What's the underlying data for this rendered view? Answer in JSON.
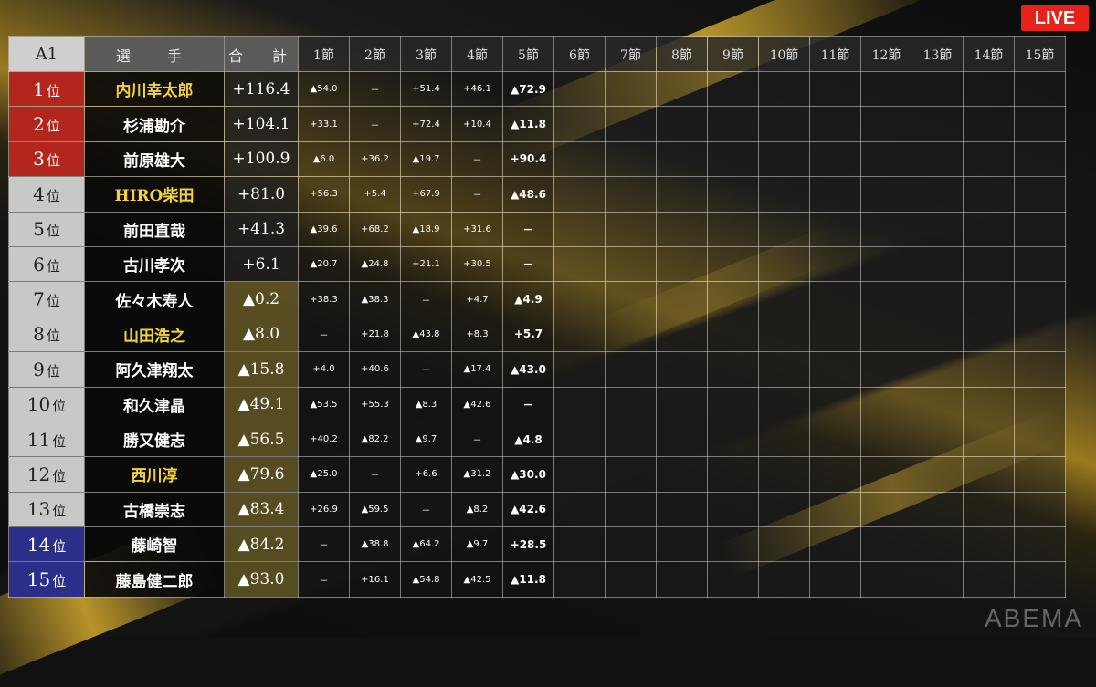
{
  "header": {
    "league": "A1",
    "player": "選　手",
    "total": "合　計",
    "rounds": [
      "1節",
      "2節",
      "3節",
      "4節",
      "5節",
      "6節",
      "7節",
      "8節",
      "9節",
      "10節",
      "11節",
      "12節",
      "13節",
      "14節",
      "15節"
    ]
  },
  "live_badge": "LIVE",
  "watermark": "ABEMA",
  "rank_unit": "位",
  "rows": [
    {
      "rank": "1",
      "name": "内川幸太郎",
      "total": "+116.4",
      "scores": [
        "▲54.0",
        "－",
        "+51.4",
        "+46.1",
        "▲72.9"
      ]
    },
    {
      "rank": "2",
      "name": "杉浦勘介",
      "total": "+104.1",
      "scores": [
        "+33.1",
        "－",
        "+72.4",
        "+10.4",
        "▲11.8"
      ]
    },
    {
      "rank": "3",
      "name": "前原雄大",
      "total": "+100.9",
      "scores": [
        "▲6.0",
        "+36.2",
        "▲19.7",
        "－",
        "+90.4"
      ]
    },
    {
      "rank": "4",
      "name": "HIRO柴田",
      "total": "+81.0",
      "scores": [
        "+56.3",
        "+5.4",
        "+67.9",
        "－",
        "▲48.6"
      ]
    },
    {
      "rank": "5",
      "name": "前田直哉",
      "total": "+41.3",
      "scores": [
        "▲39.6",
        "+68.2",
        "▲18.9",
        "+31.6",
        "－"
      ]
    },
    {
      "rank": "6",
      "name": "古川孝次",
      "total": "+6.1",
      "scores": [
        "▲20.7",
        "▲24.8",
        "+21.1",
        "+30.5",
        "－"
      ]
    },
    {
      "rank": "7",
      "name": "佐々木寿人",
      "total": "▲0.2",
      "scores": [
        "+38.3",
        "▲38.3",
        "－",
        "+4.7",
        "▲4.9"
      ]
    },
    {
      "rank": "8",
      "name": "山田浩之",
      "total": "▲8.0",
      "scores": [
        "－",
        "+21.8",
        "▲43.8",
        "+8.3",
        "+5.7"
      ]
    },
    {
      "rank": "9",
      "name": "阿久津翔太",
      "total": "▲15.8",
      "scores": [
        "+4.0",
        "+40.6",
        "－",
        "▲17.4",
        "▲43.0"
      ]
    },
    {
      "rank": "10",
      "name": "和久津晶",
      "total": "▲49.1",
      "scores": [
        "▲53.5",
        "+55.3",
        "▲8.3",
        "▲42.6",
        "－"
      ]
    },
    {
      "rank": "11",
      "name": "勝又健志",
      "total": "▲56.5",
      "scores": [
        "+40.2",
        "▲82.2",
        "▲9.7",
        "－",
        "▲4.8"
      ]
    },
    {
      "rank": "12",
      "name": "西川淳",
      "total": "▲79.6",
      "scores": [
        "▲25.0",
        "－",
        "+6.6",
        "▲31.2",
        "▲30.0"
      ]
    },
    {
      "rank": "13",
      "name": "古橋崇志",
      "total": "▲83.4",
      "scores": [
        "+26.9",
        "▲59.5",
        "－",
        "▲8.2",
        "▲42.6"
      ]
    },
    {
      "rank": "14",
      "name": "藤崎智",
      "total": "▲84.2",
      "scores": [
        "－",
        "▲38.8",
        "▲64.2",
        "▲9.7",
        "+28.5"
      ]
    },
    {
      "rank": "15",
      "name": "藤島健二郎",
      "total": "▲93.0",
      "scores": [
        "－",
        "+16.1",
        "▲54.8",
        "▲42.5",
        "▲11.8"
      ]
    }
  ],
  "highlight_names": [
    "内川幸太郎",
    "HIRO柴田",
    "山田浩之",
    "西川淳"
  ],
  "colors": {
    "rank_top": "#b3261e",
    "rank_bottom": "#2b2f8a",
    "highlight_name": "#f3d33a",
    "live": "#e5231b"
  }
}
